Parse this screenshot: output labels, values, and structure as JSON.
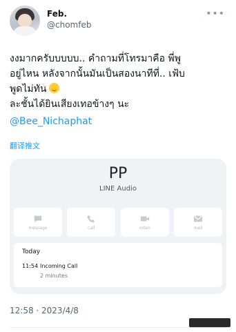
{
  "user": {
    "display_name": "Feb.",
    "handle": "@chomfeb"
  },
  "more_icon": "more-horizontal-icon",
  "tweet": {
    "lines": [
      "งงมากครับบบบบ.. คำถามที่โทรมาคือ พี่พู",
      "อยู่ไหน หลังจากนั้นมันเป็นสองนาทีที่.. เฟ้บ",
      "พูดไม่ทัน",
      "ละชั้นได้ยินเสียงเทอข้างๆ นะ"
    ],
    "emoji": "sweat-smile-emoji",
    "mention": "@Bee_Nichaphat",
    "translate_label": "翻译推文"
  },
  "line_card": {
    "contact_name": "PP",
    "subtitle": "LINE Audio",
    "actions": [
      {
        "icon": "message-icon",
        "label": "message"
      },
      {
        "icon": "phone-icon",
        "label": "call"
      },
      {
        "icon": "video-icon",
        "label": "video"
      },
      {
        "icon": "mail-icon",
        "label": "mail"
      }
    ],
    "history": {
      "day": "Today",
      "time": "11:54",
      "type": "Incoming Call",
      "duration": "2 minutes"
    }
  },
  "footer": {
    "timestamp": "12:58 · 2023/4/8"
  },
  "colors": {
    "link": "#1d9bf0",
    "card_bg": "#f0f2f5",
    "muted": "#536471"
  }
}
